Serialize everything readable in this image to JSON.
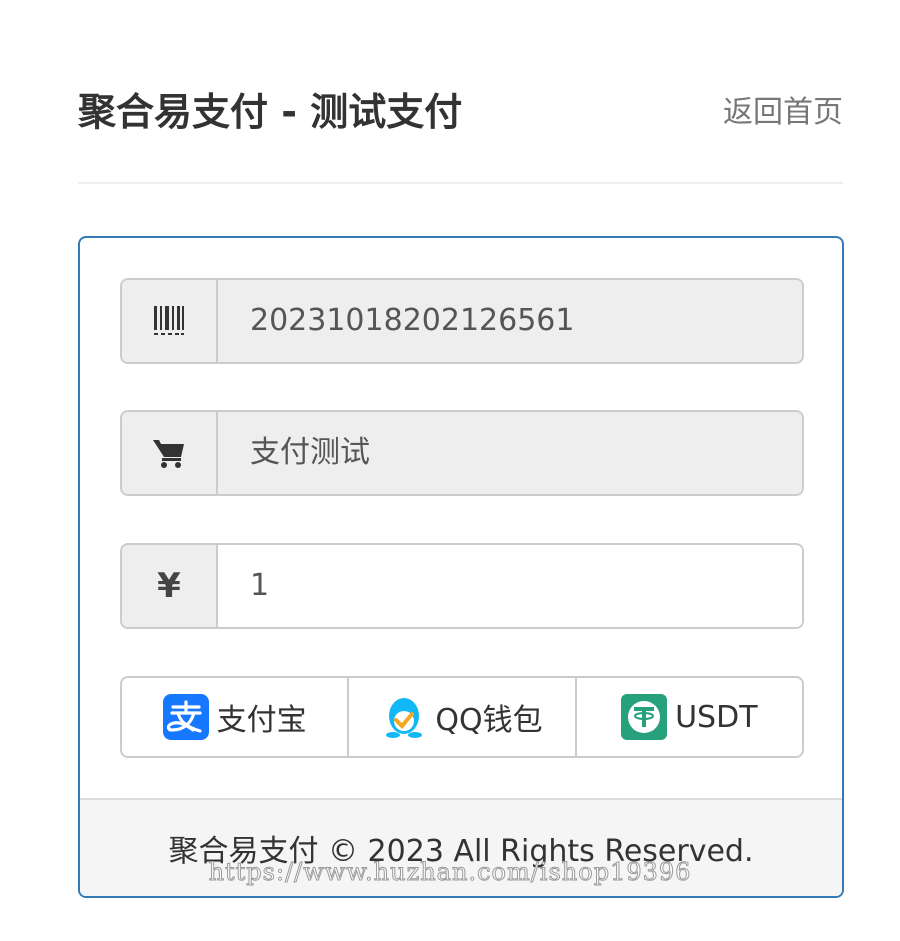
{
  "header": {
    "title": "聚合易支付 - 测试支付",
    "home_link": "返回首页"
  },
  "form": {
    "order_no": {
      "icon": "barcode-icon",
      "value": "20231018202126561"
    },
    "product_name": {
      "icon": "shopping-cart-icon",
      "value": "支付测试"
    },
    "amount": {
      "icon": "yen-icon",
      "symbol": "¥",
      "value": "1"
    }
  },
  "payment_methods": [
    {
      "label": "支付宝",
      "icon": "alipay-icon",
      "color": "#1677ff"
    },
    {
      "label": "QQ钱包",
      "icon": "qq-wallet-icon",
      "color": "#12b7f5"
    },
    {
      "label": "USDT",
      "icon": "usdt-icon",
      "color": "#26a17b"
    }
  ],
  "footer": {
    "copyright": "聚合易支付 © 2023 All Rights Reserved."
  },
  "watermark": "https://www.huzhan.com/ishop19396",
  "colors": {
    "panel_border": "#337ab7",
    "addon_bg": "#eeeeee",
    "footer_bg": "#f5f5f5"
  }
}
